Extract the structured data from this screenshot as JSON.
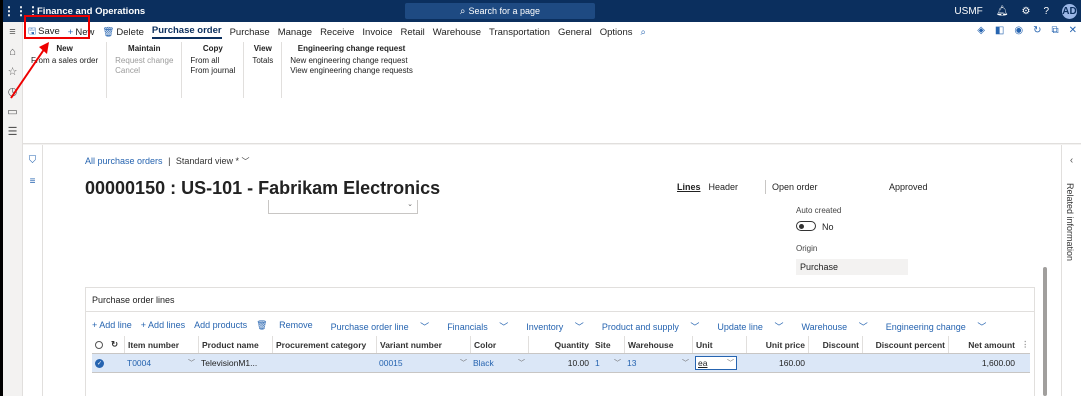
{
  "topbar": {
    "app_name": "Finance and Operations",
    "search_placeholder": "Search for a page",
    "company": "USMF",
    "avatar_initials": "AD",
    "help_label": "?"
  },
  "actionpane": {
    "save": "Save",
    "new": "New",
    "delete": "Delete",
    "tabs": [
      "Purchase order",
      "Purchase",
      "Manage",
      "Receive",
      "Invoice",
      "Retail",
      "Warehouse",
      "Transportation",
      "General",
      "Options"
    ],
    "groups": {
      "new": {
        "header": "New",
        "items": [
          "From a sales order"
        ]
      },
      "maintain": {
        "header": "Maintain",
        "items": [
          "Request change",
          "Cancel"
        ]
      },
      "copy": {
        "header": "Copy",
        "items": [
          "From all",
          "From journal"
        ]
      },
      "view": {
        "header": "View",
        "items": [
          "Totals"
        ]
      },
      "ecr": {
        "header": "Engineering change request",
        "items": [
          "New engineering change request",
          "View engineering change requests"
        ]
      }
    }
  },
  "page": {
    "breadcrumb_link": "All purchase orders",
    "breadcrumb_sep": "|",
    "view_name": "Standard view *",
    "title": "00000150 : US-101 - Fabrikam Electronics",
    "view_tabs": [
      "Lines",
      "Header"
    ],
    "order_status": "Open order",
    "approval_status": "Approved",
    "auto_created_label": "Auto created",
    "auto_created_value": "No",
    "origin_label": "Origin",
    "origin_value": "Purchase"
  },
  "lines": {
    "section_title": "Purchase order lines",
    "toolbar": [
      "+ Add line",
      "+ Add lines",
      "Add products",
      "Remove",
      "Purchase order line",
      "Financials",
      "Inventory",
      "Product and supply",
      "Update line",
      "Warehouse",
      "Engineering change"
    ],
    "columns": [
      "Item number",
      "Product name",
      "Procurement category",
      "Variant number",
      "Color",
      "Quantity",
      "Site",
      "Warehouse",
      "Unit",
      "Unit price",
      "Discount",
      "Discount percent",
      "Net amount"
    ],
    "rows": [
      {
        "item": "T0004",
        "product": "TelevisionM1...",
        "category": "",
        "variant": "00015",
        "color": "Black",
        "quantity": "10.00",
        "site": "1",
        "warehouse": "13",
        "unit": "ea",
        "unit_price": "160.00",
        "discount": "",
        "discount_percent": "",
        "net_amount": "1,600.00"
      }
    ]
  },
  "rightpane": {
    "label": "Related information"
  },
  "colors": {
    "topbar": "#0b2f5e",
    "accent": "#2664b0",
    "highlight": "#e00000",
    "selected_row": "#dbe7f7"
  }
}
